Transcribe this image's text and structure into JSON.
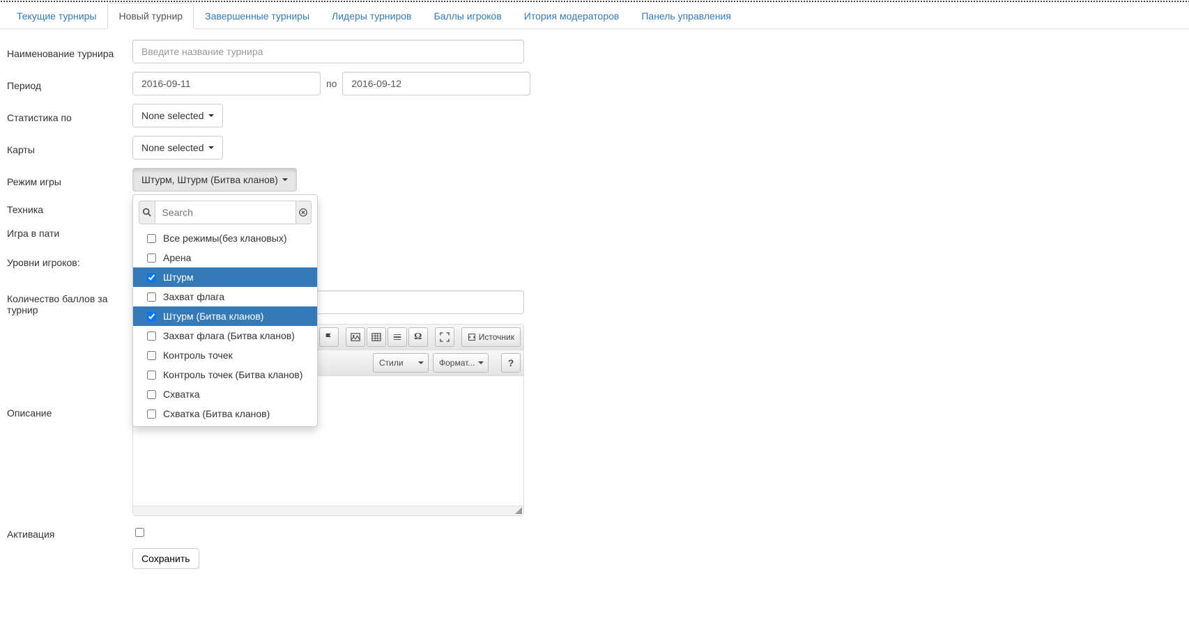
{
  "tabs": [
    {
      "label": "Текущие турниры",
      "active": false
    },
    {
      "label": "Новый турнир",
      "active": true
    },
    {
      "label": "Завершенные турниры",
      "active": false
    },
    {
      "label": "Лидеры турниров",
      "active": false
    },
    {
      "label": "Баллы игроков",
      "active": false
    },
    {
      "label": "Итория модераторов",
      "active": false
    },
    {
      "label": "Панель управления",
      "active": false
    }
  ],
  "form": {
    "name_label": "Наименование турнира",
    "name_placeholder": "Введите название турнира",
    "period_label": "Период",
    "period_from": "2016-09-11",
    "period_sep": "по",
    "period_to": "2016-09-12",
    "stats_label": "Статистика по",
    "stats_value": "None selected",
    "maps_label": "Карты",
    "maps_value": "None selected",
    "mode_label": "Режим игры",
    "mode_value": "Штурм, Штурм (Битва кланов)",
    "tech_label": "Техника",
    "party_label": "Игра в пати",
    "levels_label": "Уровни игроков:",
    "points_label": "Количество баллов за турнир",
    "desc_label": "Описание",
    "activation_label": "Активация",
    "save_label": "Сохранить"
  },
  "dropdown": {
    "search_placeholder": "Search",
    "items": [
      {
        "label": "Все режимы(без клановых)",
        "checked": false
      },
      {
        "label": "Арена",
        "checked": false
      },
      {
        "label": "Штурм",
        "checked": true
      },
      {
        "label": "Захват флага",
        "checked": false
      },
      {
        "label": "Штурм (Битва кланов)",
        "checked": true
      },
      {
        "label": "Захват флага (Битва кланов)",
        "checked": false
      },
      {
        "label": "Контроль точек",
        "checked": false
      },
      {
        "label": "Контроль точек (Битва кланов)",
        "checked": false
      },
      {
        "label": "Схватка",
        "checked": false
      },
      {
        "label": "Схватка (Битва кланов)",
        "checked": false
      }
    ]
  },
  "editor": {
    "styles_label": "Стили",
    "format_label": "Формат...",
    "source_label": "Источник"
  }
}
